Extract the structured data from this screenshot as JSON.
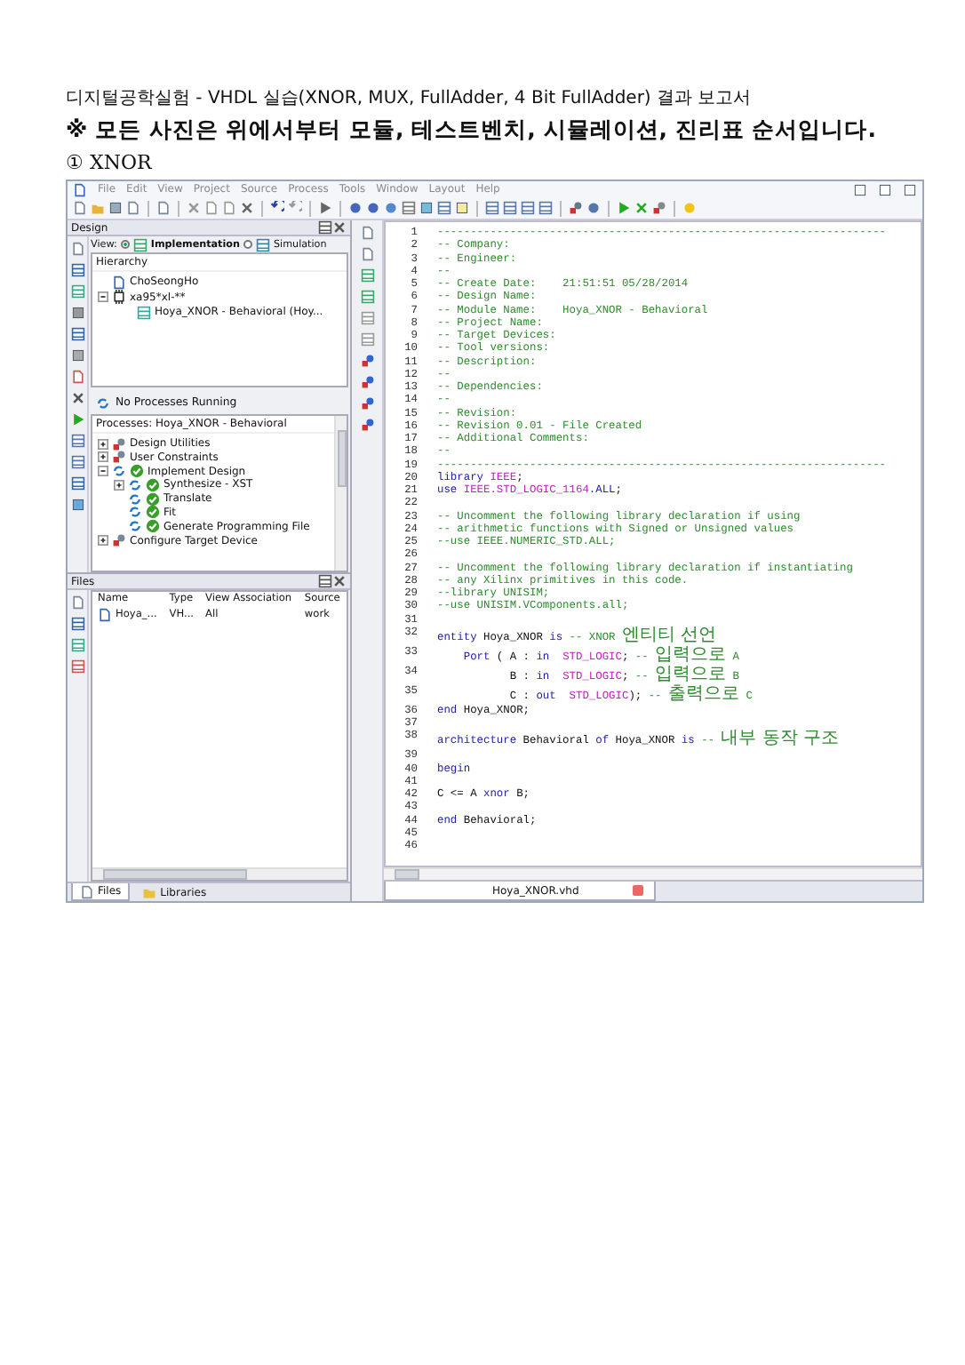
{
  "document": {
    "title": "디지털공학실험 - VHDL 실습(XNOR, MUX, FullAdder, 4 Bit FullAdder) 결과 보고서",
    "note": "※ 모든 사진은 위에서부터 모듈, 테스트벤치, 시뮬레이션, 진리표 순서입니다.",
    "section": "① XNOR"
  },
  "menu": [
    "File",
    "Edit",
    "View",
    "Project",
    "Source",
    "Process",
    "Tools",
    "Window",
    "Layout",
    "Help"
  ],
  "design_panel": {
    "title": "Design",
    "view_label": "View:",
    "views": [
      {
        "label": "Implementation",
        "selected": true
      },
      {
        "label": "Simulation",
        "selected": false
      }
    ],
    "hierarchy_title": "Hierarchy",
    "hierarchy": [
      {
        "kind": "project",
        "label": "ChoSeongHo"
      },
      {
        "kind": "device",
        "label": "xa95*xl-**",
        "expanded": true,
        "children": [
          {
            "kind": "module",
            "label": "Hoya_XNOR - Behavioral (Hoy..."
          }
        ]
      }
    ],
    "status": "No Processes Running",
    "processes_title": "Processes: Hoya_XNOR - Behavioral",
    "processes": [
      {
        "label": "Design Utilities",
        "done": false,
        "expanded": false
      },
      {
        "label": "User Constraints",
        "done": false,
        "expanded": false
      },
      {
        "label": "Implement Design",
        "done": true,
        "expanded": true,
        "children": [
          {
            "label": "Synthesize - XST",
            "done": true,
            "expanded": false
          },
          {
            "label": "Translate",
            "done": true
          },
          {
            "label": "Fit",
            "done": true
          },
          {
            "label": "Generate Programming File",
            "done": true
          }
        ]
      },
      {
        "label": "Configure Target Device",
        "done": false,
        "expanded": false
      }
    ]
  },
  "files_panel": {
    "title": "Files",
    "columns": [
      "Name",
      "Type",
      "View Association",
      "Source"
    ],
    "rows": [
      [
        "Hoya_...",
        "VH...",
        "All",
        "work"
      ]
    ],
    "tabs": [
      {
        "label": "Files",
        "selected": true
      },
      {
        "label": "Libraries",
        "selected": false
      }
    ]
  },
  "editor": {
    "tab": "Hoya_XNOR.vhd",
    "lines": [
      {
        "n": "1",
        "parts": [
          {
            "kind": "comment",
            "text": "--------------------------------------------------------------------"
          }
        ]
      },
      {
        "n": "2",
        "parts": [
          {
            "kind": "comment",
            "text": "-- Company:"
          }
        ]
      },
      {
        "n": "3",
        "parts": [
          {
            "kind": "comment",
            "text": "-- Engineer:"
          }
        ]
      },
      {
        "n": "4",
        "parts": [
          {
            "kind": "comment",
            "text": "--"
          }
        ]
      },
      {
        "n": "5",
        "parts": [
          {
            "kind": "comment",
            "text": "-- Create Date:    21:51:51 05/28/2014"
          }
        ]
      },
      {
        "n": "6",
        "parts": [
          {
            "kind": "comment",
            "text": "-- Design Name:"
          }
        ]
      },
      {
        "n": "7",
        "parts": [
          {
            "kind": "comment",
            "text": "-- Module Name:    Hoya_XNOR - Behavioral"
          }
        ]
      },
      {
        "n": "8",
        "parts": [
          {
            "kind": "comment",
            "text": "-- Project Name:"
          }
        ]
      },
      {
        "n": "9",
        "parts": [
          {
            "kind": "comment",
            "text": "-- Target Devices:"
          }
        ]
      },
      {
        "n": "10",
        "parts": [
          {
            "kind": "comment",
            "text": "-- Tool versions:"
          }
        ]
      },
      {
        "n": "11",
        "parts": [
          {
            "kind": "comment",
            "text": "-- Description:"
          }
        ]
      },
      {
        "n": "12",
        "parts": [
          {
            "kind": "comment",
            "text": "--"
          }
        ]
      },
      {
        "n": "13",
        "parts": [
          {
            "kind": "comment",
            "text": "-- Dependencies:"
          }
        ]
      },
      {
        "n": "14",
        "parts": [
          {
            "kind": "comment",
            "text": "--"
          }
        ]
      },
      {
        "n": "15",
        "parts": [
          {
            "kind": "comment",
            "text": "-- Revision:"
          }
        ]
      },
      {
        "n": "16",
        "parts": [
          {
            "kind": "comment",
            "text": "-- Revision 0.01 - File Created"
          }
        ]
      },
      {
        "n": "17",
        "parts": [
          {
            "kind": "comment",
            "text": "-- Additional Comments:"
          }
        ]
      },
      {
        "n": "18",
        "parts": [
          {
            "kind": "comment",
            "text": "--"
          }
        ]
      },
      {
        "n": "19",
        "parts": [
          {
            "kind": "comment",
            "text": "--------------------------------------------------------------------"
          }
        ]
      },
      {
        "n": "20",
        "parts": [
          {
            "kind": "keyword",
            "text": "library "
          },
          {
            "kind": "type",
            "text": "IEEE"
          },
          {
            "kind": "plain",
            "text": ";"
          }
        ]
      },
      {
        "n": "21",
        "parts": [
          {
            "kind": "keyword",
            "text": "use "
          },
          {
            "kind": "type",
            "text": "IEEE.STD_LOGIC_1164"
          },
          {
            "kind": "keyword",
            "text": ".ALL"
          },
          {
            "kind": "plain",
            "text": ";"
          }
        ]
      },
      {
        "n": "22"
      },
      {
        "n": "23",
        "parts": [
          {
            "kind": "comment",
            "text": "-- Uncomment the following library declaration if using"
          }
        ]
      },
      {
        "n": "24",
        "parts": [
          {
            "kind": "comment",
            "text": "-- arithmetic functions with Signed or Unsigned values"
          }
        ]
      },
      {
        "n": "25",
        "parts": [
          {
            "kind": "comment",
            "text": "--use IEEE.NUMERIC_STD.ALL;"
          }
        ]
      },
      {
        "n": "26"
      },
      {
        "n": "27",
        "parts": [
          {
            "kind": "comment",
            "text": "-- Uncomment the following library declaration if instantiating"
          }
        ]
      },
      {
        "n": "28",
        "parts": [
          {
            "kind": "comment",
            "text": "-- any Xilinx primitives in this code."
          }
        ]
      },
      {
        "n": "29",
        "parts": [
          {
            "kind": "comment",
            "text": "--library UNISIM;"
          }
        ]
      },
      {
        "n": "30",
        "parts": [
          {
            "kind": "comment",
            "text": "--use UNISIM.VComponents.all;"
          }
        ]
      },
      {
        "n": "31"
      },
      {
        "n": "32",
        "parts": [
          {
            "kind": "keyword",
            "text": "entity "
          },
          {
            "kind": "plain",
            "text": "Hoya_XNOR "
          },
          {
            "kind": "keyword",
            "text": "is "
          },
          {
            "kind": "comment",
            "text": "-- XNOR 엔티티 선언"
          }
        ]
      },
      {
        "n": "33",
        "parts": [
          {
            "kind": "keyword",
            "text": "    Port "
          },
          {
            "kind": "plain",
            "text": "( A : "
          },
          {
            "kind": "keyword",
            "text": "in  "
          },
          {
            "kind": "type",
            "text": "STD_LOGIC"
          },
          {
            "kind": "plain",
            "text": "; "
          },
          {
            "kind": "comment",
            "text": "-- 입력으로 A"
          }
        ]
      },
      {
        "n": "34",
        "parts": [
          {
            "kind": "plain",
            "text": "           B : "
          },
          {
            "kind": "keyword",
            "text": "in  "
          },
          {
            "kind": "type",
            "text": "STD_LOGIC"
          },
          {
            "kind": "plain",
            "text": "; "
          },
          {
            "kind": "comment",
            "text": "-- 입력으로 B"
          }
        ]
      },
      {
        "n": "35",
        "parts": [
          {
            "kind": "plain",
            "text": "           C : "
          },
          {
            "kind": "keyword",
            "text": "out  "
          },
          {
            "kind": "type",
            "text": "STD_LOGIC"
          },
          {
            "kind": "plain",
            "text": "); "
          },
          {
            "kind": "comment",
            "text": "-- 출력으로 C"
          }
        ]
      },
      {
        "n": "36",
        "parts": [
          {
            "kind": "keyword",
            "text": "end "
          },
          {
            "kind": "plain",
            "text": "Hoya_XNOR;"
          }
        ]
      },
      {
        "n": "37"
      },
      {
        "n": "38",
        "parts": [
          {
            "kind": "keyword",
            "text": "architecture "
          },
          {
            "kind": "plain",
            "text": "Behavioral "
          },
          {
            "kind": "keyword",
            "text": "of "
          },
          {
            "kind": "plain",
            "text": "Hoya_XNOR "
          },
          {
            "kind": "keyword",
            "text": "is "
          },
          {
            "kind": "comment",
            "text": "-- 내부 동작 구조"
          }
        ]
      },
      {
        "n": "39"
      },
      {
        "n": "40",
        "parts": [
          {
            "kind": "keyword",
            "text": "begin"
          }
        ]
      },
      {
        "n": "41"
      },
      {
        "n": "42",
        "parts": [
          {
            "kind": "plain",
            "text": "C <= A "
          },
          {
            "kind": "keyword",
            "text": "xnor "
          },
          {
            "kind": "plain",
            "text": "B;"
          }
        ]
      },
      {
        "n": "43"
      },
      {
        "n": "44",
        "parts": [
          {
            "kind": "keyword",
            "text": "end "
          },
          {
            "kind": "plain",
            "text": "Behavioral;"
          }
        ]
      },
      {
        "n": "45"
      },
      {
        "n": "46"
      }
    ]
  }
}
